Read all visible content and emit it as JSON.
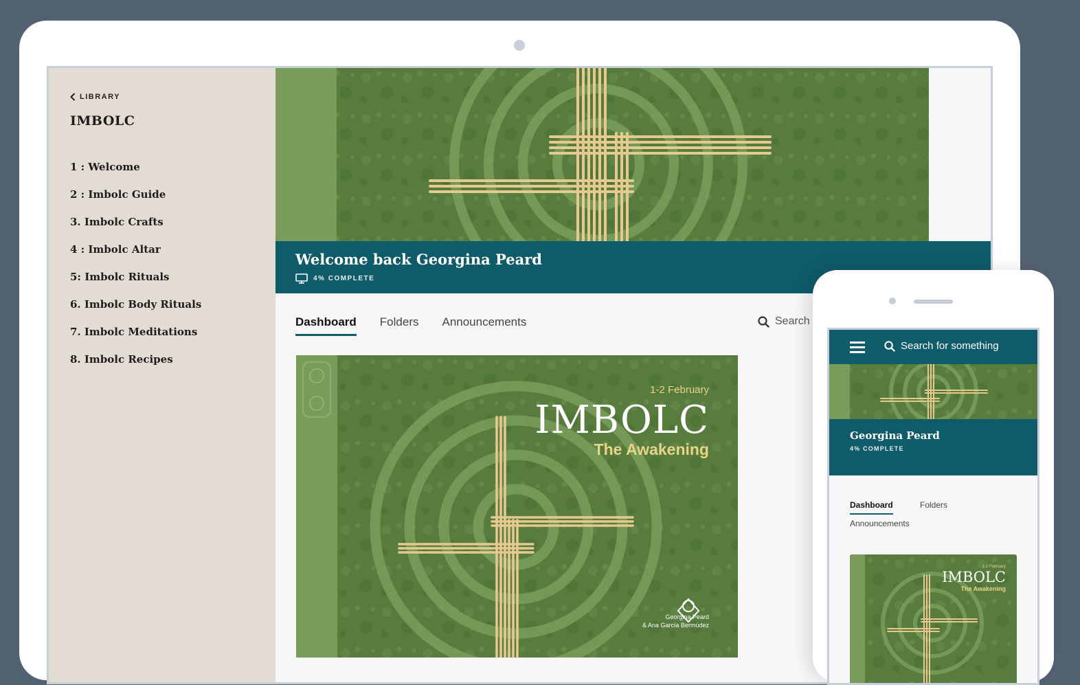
{
  "sidebar": {
    "back_label": "LIBRARY",
    "course_title": "IMBOLC",
    "lessons": [
      "1 : Welcome",
      "2 : Imbolc Guide",
      "3. Imbolc Crafts",
      "4 : Imbolc Altar",
      "5: Imbolc Rituals",
      "6. Imbolc Body Rituals",
      "7. Imbolc Meditations",
      "8. Imbolc Recipes"
    ]
  },
  "banner": {
    "welcome": "Welcome back Georgina Peard",
    "progress_label": "4% COMPLETE"
  },
  "tabs": {
    "dashboard": "Dashboard",
    "folders": "Folders",
    "announcements": "Announcements"
  },
  "search": {
    "label": "Search",
    "mobile_placeholder": "Search for something"
  },
  "card": {
    "date": "1-2 February",
    "title": "IMBOLC",
    "subtitle": "The Awakening",
    "author_1": "Georgina Peard",
    "author_2": "& Ana García Bermúdez"
  },
  "mobile": {
    "name": "Georgina Peard",
    "progress_label": "4% COMPLETE"
  },
  "colors": {
    "teal": "#0f5b6a",
    "grass": "#5a7f3f",
    "sidebar_bg": "#e2dcd2",
    "straw": "#e6c98f"
  }
}
